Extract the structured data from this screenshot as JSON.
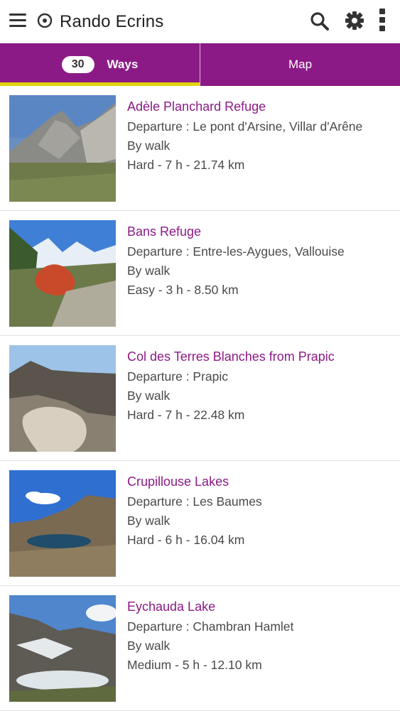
{
  "header": {
    "title": "Rando Ecrins",
    "icons": [
      "menu-icon",
      "logo-icon",
      "search-icon",
      "gear-icon",
      "more-vert-icon"
    ]
  },
  "tabs": {
    "ways_count": "30",
    "ways_label": "Ways",
    "map_label": "Map"
  },
  "colors": {
    "brand": "#8b1a86",
    "tab_indicator": "#e2d30b"
  },
  "items": [
    {
      "title": "Adèle Planchard Refuge",
      "departure": "Departure : Le pont d'Arsine, Villar d'Arêne",
      "mode": "By walk",
      "summary": "Hard - 7 h - 21.74 km"
    },
    {
      "title": "Bans Refuge",
      "departure": "Departure : Entre-les-Aygues, Vallouise",
      "mode": "By walk",
      "summary": "Easy - 3 h - 8.50 km"
    },
    {
      "title": "Col des Terres Blanches from Prapic",
      "departure": "Departure : Prapic",
      "mode": "By walk",
      "summary": "Hard - 7 h - 22.48 km"
    },
    {
      "title": "Crupillouse Lakes",
      "departure": "Departure : Les Baumes",
      "mode": "By walk",
      "summary": "Hard - 6 h - 16.04 km"
    },
    {
      "title": "Eychauda Lake",
      "departure": "Departure : Chambran Hamlet",
      "mode": "By walk",
      "summary": "Medium - 5 h - 12.10 km"
    }
  ]
}
